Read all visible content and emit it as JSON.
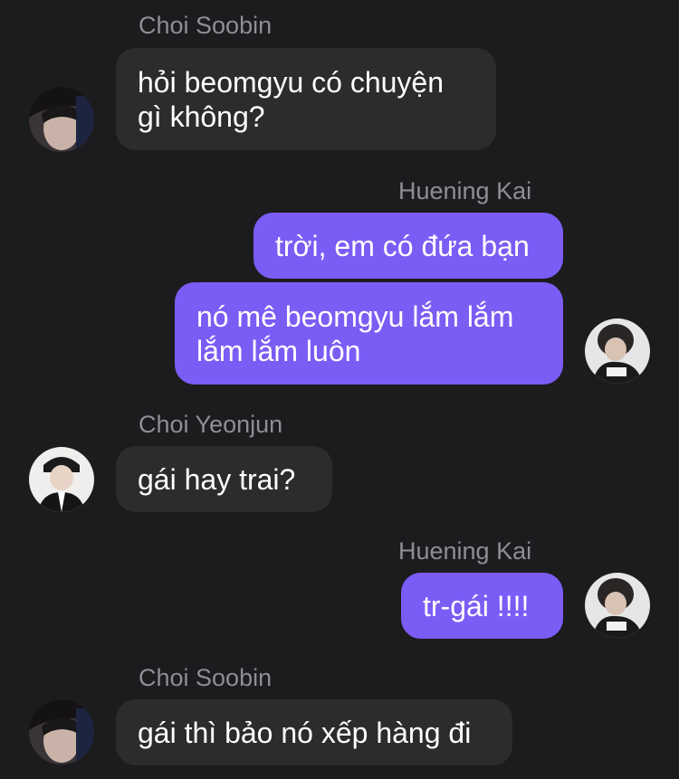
{
  "messages": [
    {
      "sender": "Choi Soobin",
      "text": "hỏi beomgyu có chuyện gì không?",
      "direction": "incoming"
    },
    {
      "sender": "Huening Kai",
      "text": "trời, em có đứa bạn",
      "direction": "outgoing"
    },
    {
      "sender": "Huening Kai",
      "text": "nó mê beomgyu lắm lắm lắm lắm luôn",
      "direction": "outgoing"
    },
    {
      "sender": "Choi Yeonjun",
      "text": "gái hay trai?",
      "direction": "incoming"
    },
    {
      "sender": "Huening Kai",
      "text": "tr-gái !!!!",
      "direction": "outgoing"
    },
    {
      "sender": "Choi Soobin",
      "text": "gái thì bảo nó xếp hàng đi",
      "direction": "incoming"
    }
  ],
  "colors": {
    "background": "#1c1c1e",
    "incoming_bubble": "#2c2c2e",
    "outgoing_bubble": "#7b5cf5",
    "sender_name": "#8e8e93"
  },
  "icons": {
    "soobin_avatar": "soobin-avatar-photo",
    "hueningkai_avatar": "hueningkai-avatar-photo",
    "yeonjun_avatar": "yeonjun-avatar-photo"
  }
}
